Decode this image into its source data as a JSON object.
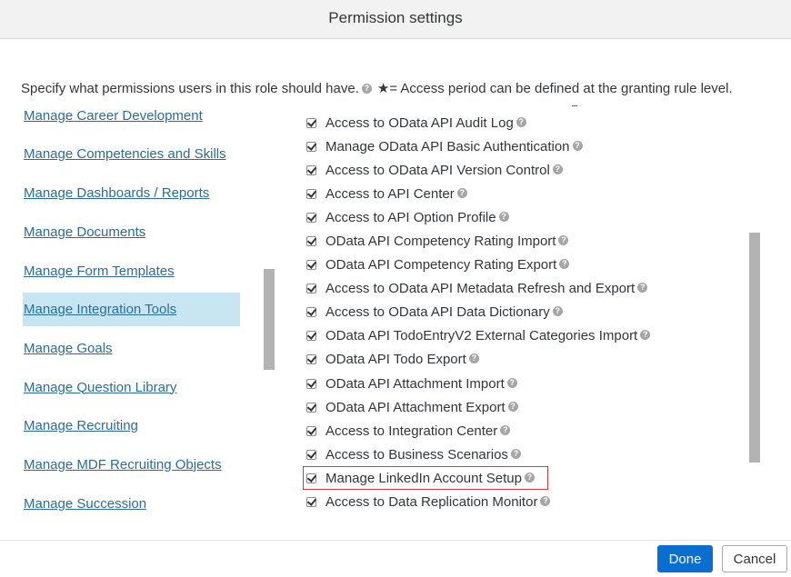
{
  "dialog": {
    "title": "Permission settings",
    "description": "Specify what permissions users in this role should have.",
    "star_note": "★= Access period can be defined at the granting rule level."
  },
  "categories": [
    {
      "label": "Manage Career Development",
      "selected": false
    },
    {
      "label": "Manage Competencies and Skills",
      "selected": false
    },
    {
      "label": "Manage Dashboards / Reports",
      "selected": false
    },
    {
      "label": "Manage Documents",
      "selected": false
    },
    {
      "label": "Manage Form Templates",
      "selected": false
    },
    {
      "label": "Manage Integration Tools",
      "selected": true
    },
    {
      "label": "Manage Goals",
      "selected": false
    },
    {
      "label": "Manage Question Library",
      "selected": false
    },
    {
      "label": "Manage Recruiting",
      "selected": false
    },
    {
      "label": "Manage MDF Recruiting Objects",
      "selected": false
    },
    {
      "label": "Manage Succession",
      "selected": false
    }
  ],
  "permissions": [
    {
      "label": "Access to OData API Audit Log",
      "checked": true
    },
    {
      "label": "Manage OData API Basic Authentication",
      "checked": true
    },
    {
      "label": "Access to OData API Version Control",
      "checked": true
    },
    {
      "label": "Access to API Center",
      "checked": true
    },
    {
      "label": "Access to API Option Profile",
      "checked": true
    },
    {
      "label": "OData API Competency Rating Import",
      "checked": true
    },
    {
      "label": "OData API Competency Rating Export",
      "checked": true
    },
    {
      "label": "Access to OData API Metadata Refresh and Export",
      "checked": true
    },
    {
      "label": "Access to OData API Data Dictionary",
      "checked": true
    },
    {
      "label": "OData API TodoEntryV2 External Categories Import",
      "checked": true
    },
    {
      "label": "OData API Todo Export",
      "checked": true
    },
    {
      "label": "OData API Attachment Import",
      "checked": true
    },
    {
      "label": "OData API Attachment Export",
      "checked": true
    },
    {
      "label": "Access to Integration Center",
      "checked": true
    },
    {
      "label": "Access to Business Scenarios",
      "checked": true
    },
    {
      "label": "Manage LinkedIn Account Setup",
      "checked": true,
      "highlighted": true
    },
    {
      "label": "Access to Data Replication Monitor",
      "checked": true
    }
  ],
  "help_glyph": "?",
  "colors": {
    "link": "#2a6d9c",
    "selected_bg": "#c8e6f1",
    "primary_button": "#0a6ed1",
    "highlight_border": "#d9363e"
  },
  "footer": {
    "done_label": "Done",
    "cancel_label": "Cancel"
  }
}
